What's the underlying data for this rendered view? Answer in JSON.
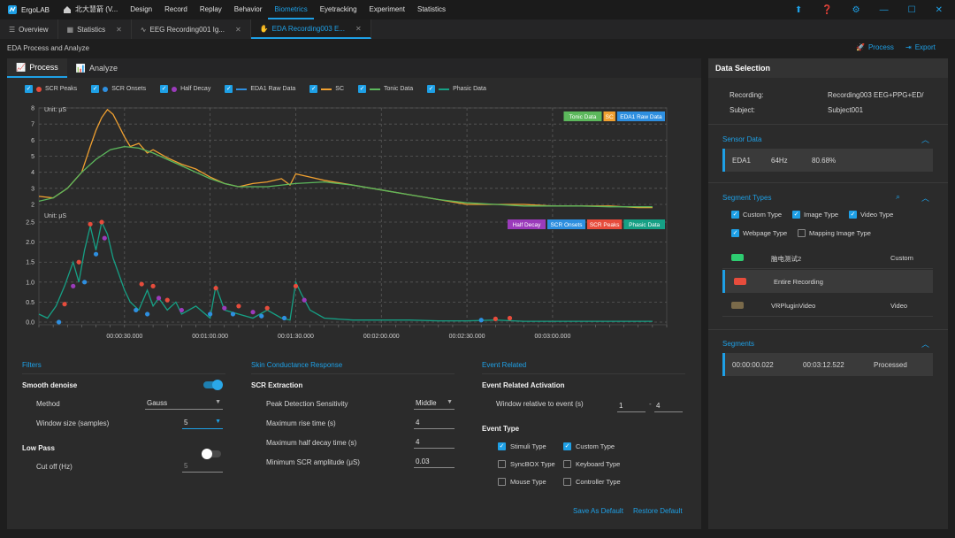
{
  "app": {
    "name": "ErgoLAB"
  },
  "menu": {
    "project": "北大慧箭 (V...",
    "items": [
      "Design",
      "Record",
      "Replay",
      "Behavior",
      "Biometrics",
      "Eyetracking",
      "Experiment",
      "Statistics"
    ],
    "active_index": 4
  },
  "window_icons": [
    "upload-icon",
    "help-icon",
    "settings-icon",
    "minimize-icon",
    "maximize-icon",
    "close-icon"
  ],
  "tabs": [
    {
      "label": "Overview",
      "icon": "overview-icon"
    },
    {
      "label": "Statistics",
      "icon": "statistics-icon"
    },
    {
      "label": "EEG Recording001 Ig...",
      "icon": "eeg-icon"
    },
    {
      "label": "EDA Recording003 E...",
      "icon": "hand-icon",
      "active": true
    }
  ],
  "subtitle": "EDA Process and Analyze",
  "toolbar": {
    "process": "Process",
    "export": "Export"
  },
  "panel_tabs": {
    "process": "Process",
    "analyze": "Analyze"
  },
  "legend": [
    {
      "label": "SCR Peaks",
      "marker": "dot",
      "color": "#e74c3c"
    },
    {
      "label": "SCR Onsets",
      "marker": "dot",
      "color": "#2e8fe0"
    },
    {
      "label": "Half Decay",
      "marker": "dot",
      "color": "#9b3bbb"
    },
    {
      "label": "EDA1 Raw Data",
      "marker": "line",
      "color": "#2e8fe0"
    },
    {
      "label": "SC",
      "marker": "line",
      "color": "#f0a030"
    },
    {
      "label": "Tonic Data",
      "marker": "line",
      "color": "#5cb85c"
    },
    {
      "label": "Phasic Data",
      "marker": "line",
      "color": "#16a085"
    }
  ],
  "colors": {
    "accent": "#1ea0e6",
    "sc": "#f0a030",
    "tonic": "#5cb85c",
    "phasic": "#16a085",
    "peaks": "#e74c3c",
    "onsets": "#2e8fe0",
    "halfdecay": "#9b3bbb"
  },
  "chart_data": [
    {
      "type": "line",
      "ylabel": "Unit: μS",
      "ylim": [
        2,
        8
      ],
      "yticks": [
        "8",
        "7",
        "6",
        "5",
        "4",
        "3",
        "2"
      ],
      "xlim": [
        0,
        220
      ],
      "xticks": [
        "00:00:30.000",
        "00:01:00.000",
        "00:01:30.000",
        "00:02:00.000",
        "00:02:30.000",
        "00:03:00.000"
      ],
      "xtick_values": [
        30,
        60,
        90,
        120,
        150,
        180
      ],
      "tags": [
        "Tonic Data",
        "SC",
        "EDA1 Raw Data"
      ],
      "series": [
        {
          "name": "SC",
          "color": "#f0a030",
          "x": [
            0,
            5,
            10,
            15,
            18,
            20,
            22,
            24,
            26,
            28,
            30,
            32,
            35,
            38,
            40,
            45,
            50,
            55,
            60,
            65,
            70,
            75,
            80,
            85,
            88,
            90,
            95,
            100,
            110,
            120,
            130,
            140,
            150,
            160,
            170,
            180,
            190,
            200,
            210,
            215
          ],
          "y": [
            2.5,
            2.4,
            3.0,
            4.0,
            5.6,
            6.6,
            7.4,
            7.9,
            7.6,
            6.9,
            6.2,
            5.6,
            5.8,
            5.2,
            5.4,
            4.9,
            4.5,
            4.2,
            3.7,
            3.3,
            3.1,
            3.3,
            3.4,
            3.6,
            3.2,
            3.9,
            3.7,
            3.5,
            3.2,
            2.9,
            2.6,
            2.3,
            2.0,
            2.0,
            2.0,
            1.9,
            1.9,
            1.9,
            1.8,
            1.8
          ]
        },
        {
          "name": "Tonic Data",
          "color": "#5cb85c",
          "x": [
            0,
            5,
            10,
            15,
            20,
            25,
            30,
            35,
            40,
            45,
            50,
            55,
            60,
            65,
            70,
            80,
            90,
            100,
            110,
            120,
            130,
            140,
            150,
            160,
            170,
            180,
            190,
            200,
            210,
            215
          ],
          "y": [
            2.2,
            2.4,
            3.0,
            4.0,
            4.8,
            5.4,
            5.6,
            5.5,
            5.2,
            4.8,
            4.4,
            4.0,
            3.6,
            3.3,
            3.1,
            3.1,
            3.3,
            3.4,
            3.2,
            2.9,
            2.6,
            2.3,
            2.1,
            2.0,
            1.9,
            1.9,
            1.9,
            1.85,
            1.85,
            1.85
          ]
        }
      ]
    },
    {
      "type": "line",
      "ylabel": "Unit: μS",
      "ylim": [
        0,
        2.7
      ],
      "yticks": [
        "2.5",
        "2.0",
        "1.5",
        "1.0",
        "0.5",
        "0.0"
      ],
      "xlim": [
        0,
        220
      ],
      "tags": [
        "Half Decay",
        "SCR Onsets",
        "SCR Peaks",
        "Phasic Data"
      ],
      "series": [
        {
          "name": "Phasic Data",
          "color": "#16a085",
          "x": [
            0,
            3,
            6,
            9,
            12,
            14,
            16,
            18,
            20,
            22,
            24,
            26,
            28,
            30,
            32,
            35,
            38,
            40,
            42,
            45,
            48,
            50,
            55,
            60,
            62,
            65,
            70,
            75,
            80,
            85,
            88,
            90,
            92,
            95,
            100,
            110,
            120,
            130,
            140,
            150,
            160,
            170,
            180,
            190,
            200,
            210,
            215
          ],
          "y": [
            0.2,
            0.1,
            0.4,
            0.9,
            1.5,
            1.0,
            1.8,
            2.4,
            1.8,
            2.5,
            2.2,
            1.6,
            1.2,
            0.8,
            0.5,
            0.3,
            0.8,
            0.4,
            0.6,
            0.3,
            0.5,
            0.2,
            0.4,
            0.1,
            0.9,
            0.3,
            0.2,
            0.1,
            0.3,
            0.1,
            0.05,
            1.0,
            0.7,
            0.3,
            0.1,
            0.05,
            0.05,
            0.05,
            0.03,
            0.03,
            0.05,
            0.02,
            0.02,
            0.02,
            0.02,
            0.02,
            0.02
          ]
        },
        {
          "name": "SCR Peaks",
          "color": "#e74c3c",
          "x": [
            9,
            14,
            18,
            22,
            36,
            40,
            45,
            62,
            70,
            80,
            90,
            160,
            165
          ],
          "y": [
            0.45,
            1.5,
            2.45,
            2.5,
            0.95,
            0.9,
            0.55,
            0.85,
            0.4,
            0.35,
            0.9,
            0.08,
            0.1
          ]
        },
        {
          "name": "SCR Onsets",
          "color": "#2e8fe0",
          "x": [
            7,
            16,
            20,
            34,
            38,
            60,
            68,
            78,
            86,
            155
          ],
          "y": [
            0.0,
            1.0,
            1.7,
            0.3,
            0.2,
            0.2,
            0.2,
            0.15,
            0.1,
            0.05
          ]
        },
        {
          "name": "Half Decay",
          "color": "#9b3bbb",
          "x": [
            12,
            23,
            42,
            50,
            65,
            75,
            93
          ],
          "y": [
            0.9,
            2.1,
            0.6,
            0.3,
            0.35,
            0.25,
            0.55
          ]
        }
      ]
    }
  ],
  "filters": {
    "title": "Filters",
    "smooth_denoise": "Smooth denoise",
    "method_label": "Method",
    "method_value": "Gauss",
    "window_label": "Window size (samples)",
    "window_value": "5",
    "low_pass": "Low Pass",
    "cutoff_label": "Cut off (Hz)",
    "cutoff_value": "5"
  },
  "scr": {
    "title": "Skin Conductance Response",
    "extraction": "SCR Extraction",
    "sensitivity_label": "Peak Detection Sensitivity",
    "sensitivity_value": "Middle",
    "rise_label": "Maximum rise time (s)",
    "rise_value": "4",
    "decay_label": "Maximum half decay time (s)",
    "decay_value": "4",
    "amp_label": "Minimum SCR amplitude (μS)",
    "amp_value": "0.03"
  },
  "event": {
    "title": "Event Related",
    "activation": "Event Related Activation",
    "window_label": "Window relative to event (s)",
    "from": "1",
    "sep": "-",
    "to": "4",
    "type_title": "Event Type",
    "types": [
      {
        "label": "Stimuli Type",
        "checked": true
      },
      {
        "label": "Custom Type",
        "checked": true
      },
      {
        "label": "SyncBOX Type",
        "checked": false
      },
      {
        "label": "Keyboard Type",
        "checked": false
      },
      {
        "label": "Mouse Type",
        "checked": false
      },
      {
        "label": "Controller Type",
        "checked": false
      }
    ],
    "save_default": "Save As Default",
    "restore_default": "Restore Default"
  },
  "data_selection": {
    "title": "Data Selection",
    "recording_label": "Recording:",
    "recording_value": "Recording003 EEG+PPG+ED/",
    "subject_label": "Subject:",
    "subject_value": "Subject001",
    "sensor_title": "Sensor Data",
    "sensor": {
      "name": "EDA1",
      "rate": "64Hz",
      "pct": "80.68%"
    },
    "segment_types_title": "Segment Types",
    "segment_types": [
      {
        "label": "Custom Type",
        "checked": true
      },
      {
        "label": "Image Type",
        "checked": true
      },
      {
        "label": "Video Type",
        "checked": true
      },
      {
        "label": "Webpage Type",
        "checked": true
      },
      {
        "label": "Mapping Image Type",
        "checked": false
      }
    ],
    "segment_list": [
      {
        "name": "脑电测试2",
        "type": "Custom"
      },
      {
        "name": "Entire Recording",
        "type": ""
      },
      {
        "name": "VRPluginVideo",
        "type": "Video"
      }
    ],
    "segments_title": "Segments",
    "segment": {
      "start": "00:00:00.022",
      "end": "00:03:12.522",
      "status": "Processed"
    }
  }
}
